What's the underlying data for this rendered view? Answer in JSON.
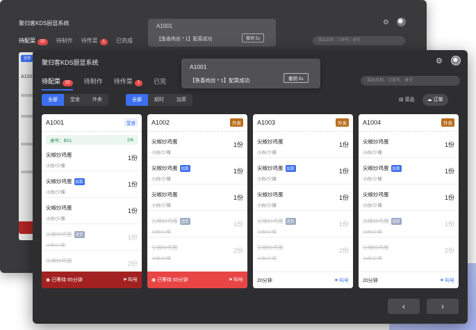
{
  "app_title": "聚归客KDS厨显系统",
  "back_toast": {
    "id": "A1001",
    "message": "【鱼香肉丝 * 1】配菜成功",
    "undo": "撤销 5s"
  },
  "back_window": {
    "tabs": [
      {
        "label": "待配菜",
        "badge": "32"
      },
      {
        "label": "待制作",
        "badge": ""
      },
      {
        "label": "待传菜",
        "badge": "1"
      },
      {
        "label": "已完成",
        "badge": ""
      }
    ],
    "search_placeholder": "菜品名称、订单号、桌号",
    "filter_label": "全部",
    "order_id": "A100"
  },
  "toast": {
    "id": "A1001",
    "message": "【鱼香肉丝 * 1】配菜成功",
    "undo": "撤销 5s"
  },
  "tabs": [
    {
      "label": "待配菜",
      "badge": "32"
    },
    {
      "label": "待制作",
      "badge": ""
    },
    {
      "label": "待传菜",
      "badge": "1"
    },
    {
      "label": "已完",
      "badge": ""
    }
  ],
  "search_placeholder": "菜品名称、订单号、桌号",
  "filters1": [
    "全部",
    "堂食",
    "外卖"
  ],
  "filters2": [
    "全部",
    "超时",
    "加菜"
  ],
  "view_toggle": {
    "dish": "菜品",
    "order": "订单"
  },
  "orders": [
    {
      "id": "A1001",
      "tag": "堂食",
      "table_label": "桌号：B01",
      "table_progress": "2/6",
      "items": [
        {
          "name": "尖椒炒鸡蛋",
          "spec": "小份/少辣",
          "qty": "1份",
          "add": ""
        },
        {
          "name": "尖椒炒鸡蛋",
          "spec": "小份/少辣",
          "qty": "1份",
          "add": "加菜"
        },
        {
          "name": "尖椒炒鸡蛋",
          "spec": "小份/少辣",
          "qty": "1份",
          "add": ""
        },
        {
          "name": "尖椒炒鸡蛋",
          "spec": "小份/少辣",
          "qty": "1份",
          "add": "退菜"
        },
        {
          "name": "尖椒炒鸡蛋",
          "spec": "",
          "qty": "2份",
          "add": ""
        }
      ],
      "footer": {
        "wait": "已等待 65分钟",
        "call": "叫号"
      }
    },
    {
      "id": "A1002",
      "tag": "外卖",
      "items": [
        {
          "name": "尖椒炒鸡蛋",
          "spec": "小份/少辣",
          "qty": "1份",
          "add": ""
        },
        {
          "name": "尖椒炒鸡蛋",
          "spec": "小份/少辣",
          "qty": "1份",
          "add": "加菜"
        },
        {
          "name": "尖椒炒鸡蛋",
          "spec": "小份/少辣",
          "qty": "1份",
          "add": ""
        },
        {
          "name": "尖椒炒鸡蛋",
          "spec": "小份/少辣",
          "qty": "1份",
          "add": "退菜"
        },
        {
          "name": "尖椒炒鸡蛋",
          "spec": "小份/少辣",
          "qty": "2份",
          "add": ""
        }
      ],
      "footer": {
        "wait": "已等待 65分钟",
        "call": "叫号"
      }
    },
    {
      "id": "A1003",
      "tag": "外卖",
      "items": [
        {
          "name": "尖椒炒鸡蛋",
          "spec": "小份/少辣",
          "qty": "1份",
          "add": ""
        },
        {
          "name": "尖椒炒鸡蛋",
          "spec": "小份/少辣",
          "qty": "1份",
          "add": "加菜"
        },
        {
          "name": "尖椒炒鸡蛋",
          "spec": "小份/少辣",
          "qty": "1份",
          "add": ""
        },
        {
          "name": "尖椒炒鸡蛋",
          "spec": "小份/少辣",
          "qty": "1份",
          "add": "退菜"
        },
        {
          "name": "尖椒炒鸡蛋",
          "spec": "小份/少辣",
          "qty": "2份",
          "add": ""
        }
      ],
      "footer": {
        "wait": "20分钟",
        "call": "叫号"
      }
    },
    {
      "id": "A1004",
      "tag": "外卖",
      "items": [
        {
          "name": "尖椒炒鸡蛋",
          "spec": "小份/少辣",
          "qty": "1份",
          "add": ""
        },
        {
          "name": "尖椒炒鸡蛋",
          "spec": "小份/少辣",
          "qty": "1份",
          "add": "加菜"
        },
        {
          "name": "尖椒炒鸡蛋",
          "spec": "小份/少辣",
          "qty": "1份",
          "add": ""
        },
        {
          "name": "尖椒炒鸡蛋",
          "spec": "小份/少辣",
          "qty": "1份",
          "add": "退菜"
        },
        {
          "name": "尖椒炒鸡蛋",
          "spec": "小份/少辣",
          "qty": "2份",
          "add": ""
        }
      ],
      "footer": {
        "wait": "20分钟",
        "call": "叫号"
      }
    }
  ],
  "colors": {
    "accent": "#3c6ff0",
    "badge": "#e84a4a",
    "takeout": "#b86e1a",
    "late": "#e84545",
    "late_dark": "#a32121"
  }
}
